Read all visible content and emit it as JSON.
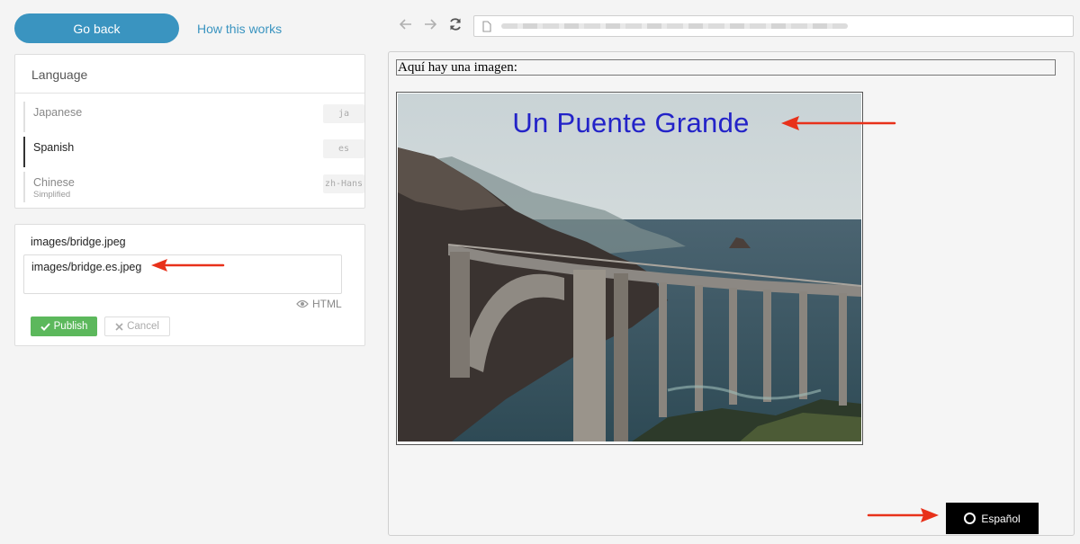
{
  "header": {
    "go_back_label": "Go back",
    "how_works_label": "How this works"
  },
  "language_panel": {
    "title": "Language",
    "items": [
      {
        "name": "Japanese",
        "sub": "",
        "code": "ja",
        "active": false
      },
      {
        "name": "Spanish",
        "sub": "",
        "code": "es",
        "active": true
      },
      {
        "name": "Chinese",
        "sub": "Simplified",
        "code": "zh-Hans",
        "active": false
      }
    ]
  },
  "editor": {
    "source_label": "images/bridge.jpeg",
    "translation_value": "images/bridge.es.jpeg",
    "html_toggle_label": "HTML",
    "publish_label": "Publish",
    "cancel_label": "Cancel"
  },
  "browser": {
    "back_icon": "arrow-left-icon",
    "forward_icon": "arrow-right-icon",
    "reload_icon": "reload-icon"
  },
  "preview": {
    "heading": "Aquí hay una imagen:",
    "image_title": "Un Puente Grande",
    "language_switch_label": "Español"
  },
  "colors": {
    "accent": "#3a94c0",
    "publish": "#5cb85c",
    "image_title": "#2323c8",
    "annotation_arrow": "#e8311a"
  }
}
